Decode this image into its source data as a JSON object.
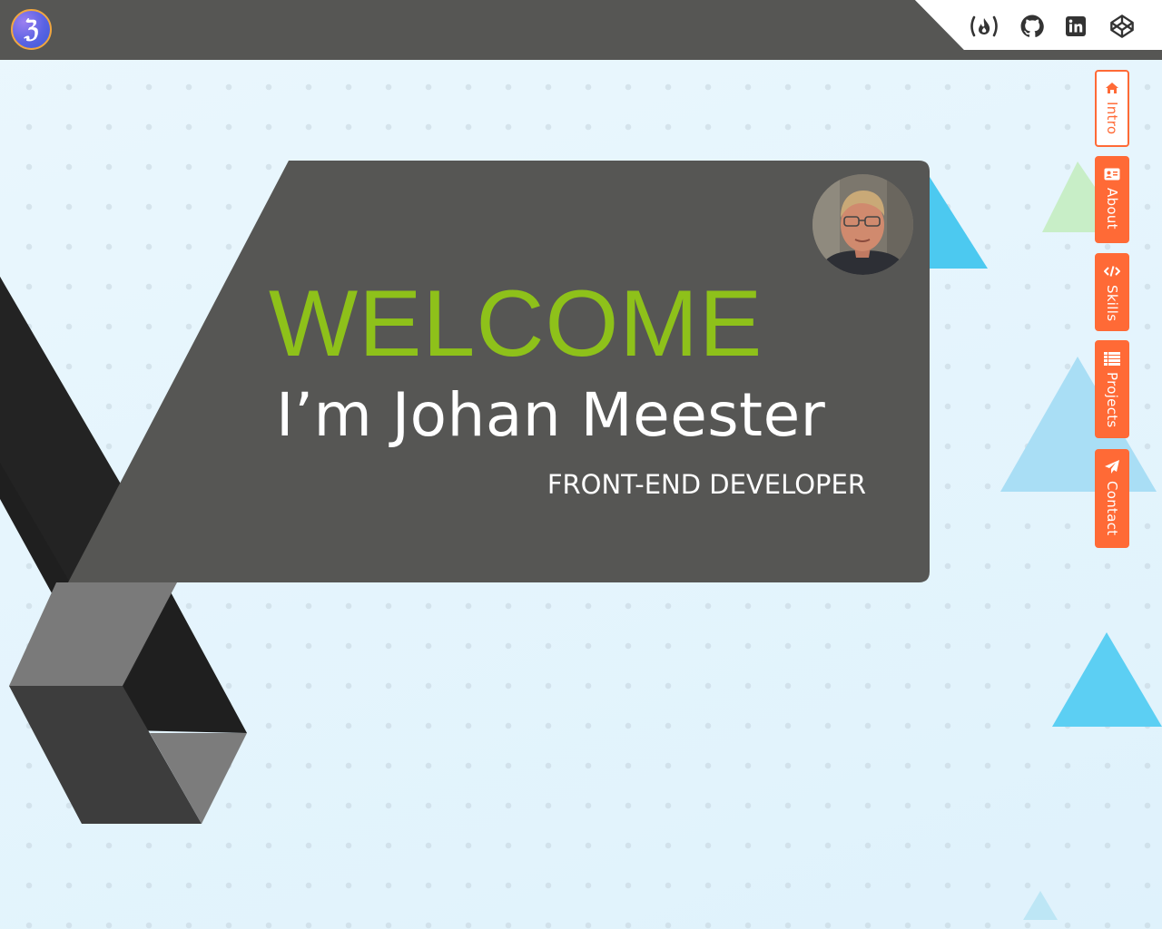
{
  "header": {
    "logo_text": "ℨ",
    "bar_color": "#565654",
    "social": [
      {
        "name": "freecodecamp-icon"
      },
      {
        "name": "github-icon"
      },
      {
        "name": "linkedin-icon"
      },
      {
        "name": "codepen-icon"
      }
    ]
  },
  "hero": {
    "welcome": "WELCOME",
    "name": "I’m Johan Meester",
    "role": "FRONT-END DEVELOPER",
    "welcome_color": "#8ec11a",
    "card_color": "#565654"
  },
  "nav": {
    "accent": "#ff6a36",
    "items": [
      {
        "label": "Intro",
        "icon": "home-icon",
        "active": true
      },
      {
        "label": "About",
        "icon": "id-card-icon",
        "active": false
      },
      {
        "label": "Skills",
        "icon": "code-icon",
        "active": false
      },
      {
        "label": "Projects",
        "icon": "list-icon",
        "active": false
      },
      {
        "label": "Contact",
        "icon": "paper-plane-icon",
        "active": false
      }
    ]
  }
}
